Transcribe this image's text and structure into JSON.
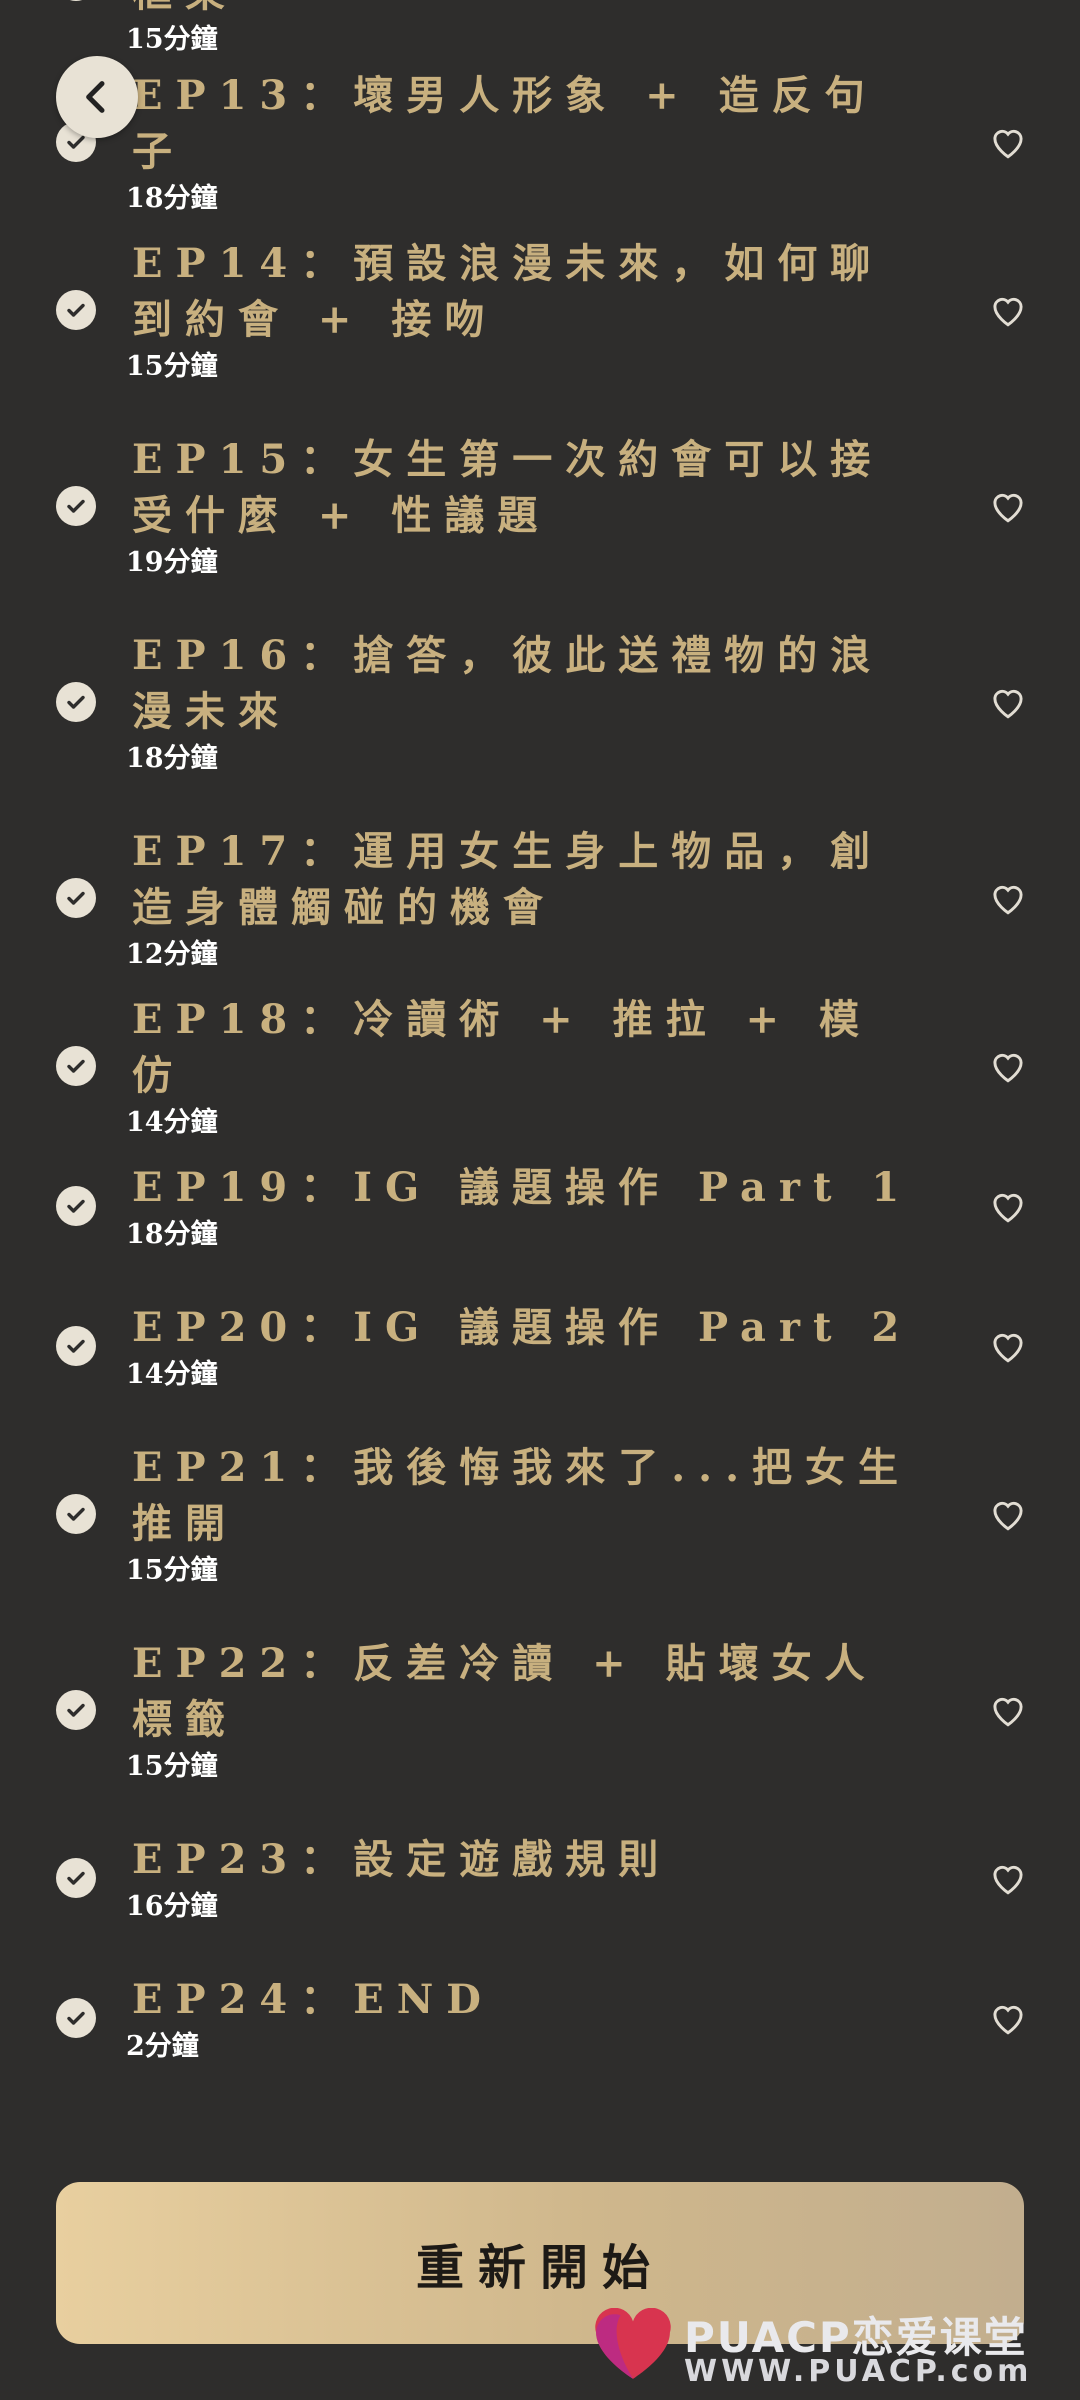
{
  "episodes": [
    {
      "title": "框架",
      "duration": "15分鐘"
    },
    {
      "title": "EP13：壞男人形象 + 造反句子",
      "duration": "18分鐘"
    },
    {
      "title": "EP14：預設浪漫未來，如何聊到約會 + 接吻",
      "duration": "15分鐘"
    },
    {
      "title": "EP15：女生第一次約會可以接受什麼 + 性議題",
      "duration": "19分鐘"
    },
    {
      "title": "EP16：搶答，彼此送禮物的浪漫未來",
      "duration": "18分鐘"
    },
    {
      "title": "EP17：運用女生身上物品，創造身體觸碰的機會",
      "duration": "12分鐘"
    },
    {
      "title": "EP18：冷讀術 + 推拉 + 模仿",
      "duration": "14分鐘"
    },
    {
      "title": "EP19：IG 議題操作 Part 1",
      "duration": "18分鐘"
    },
    {
      "title": "EP20：IG 議題操作 Part 2",
      "duration": "14分鐘"
    },
    {
      "title": "EP21：我後悔我來了...把女生推開",
      "duration": "15分鐘"
    },
    {
      "title": "EP22：反差冷讀 + 貼壞女人標籤",
      "duration": "15分鐘"
    },
    {
      "title": "EP23：設定遊戲規則",
      "duration": "16分鐘"
    },
    {
      "title": "EP24：END",
      "duration": "2分鐘"
    }
  ],
  "restart_label": "重新開始",
  "watermark": {
    "line1": "PUACP恋爱课堂",
    "line2": "WWW.PUACP.com"
  },
  "icons": {
    "back": "chevron-left-icon",
    "check": "check-circle-icon",
    "favorite": "heart-outline-icon",
    "watermark": "heart-logo-icon"
  },
  "colors": {
    "background": "#2e2d2c",
    "title_gold": "#c8b07f",
    "button_gold": "#e8cf9f",
    "check_fill": "#e8e2d5"
  }
}
